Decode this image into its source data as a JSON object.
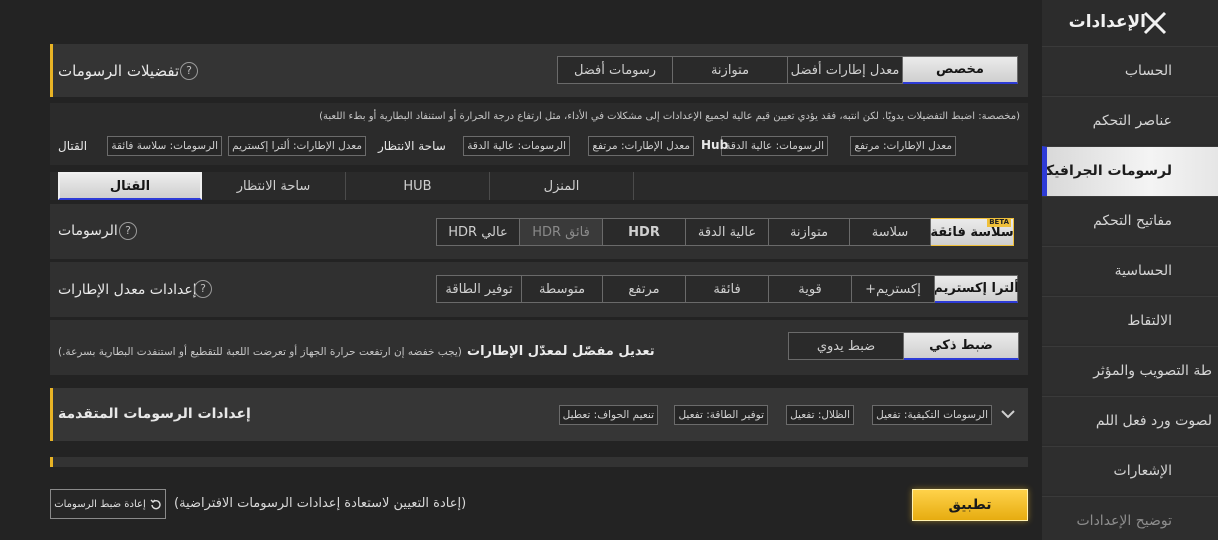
{
  "header": {
    "title": "الإعدادات"
  },
  "sidebar": {
    "items": [
      {
        "label": "الحساب"
      },
      {
        "label": "عناصر التحكم"
      },
      {
        "label": "لرسومات الجرافيكية"
      },
      {
        "label": "مفاتيح التحكم"
      },
      {
        "label": "الحساسية"
      },
      {
        "label": "الالتقاط"
      },
      {
        "label": "طة التصويب والمؤثر"
      },
      {
        "label": "لصوت ورد فعل اللم"
      },
      {
        "label": "الإشعارات"
      },
      {
        "label": "توضيح الإعدادات"
      }
    ],
    "active_index": 2
  },
  "preferences": {
    "title": "تفضيلات الرسومات",
    "help": "?",
    "options": [
      "مخصص",
      "معدل إطارات أفضل",
      "متوازنة",
      "رسومات أفضل"
    ],
    "selected": "مخصص",
    "note": "(مخصصة: اضبط التفضيلات يدويًا. لكن انتبه، فقد يؤدي تعيين قيم عالية لجميع الإعدادات إلى مشكلات في الأداء، مثل ارتفاع درجة الحرارة أو استنفاد البطارية أو بطء اللعبة)",
    "summary": [
      {
        "mode": "Hub",
        "chips": [
          "معدل الإطارات: مرتفع",
          "الرسومات: عالية الدقة"
        ]
      },
      {
        "mode": "ساحة الانتظار",
        "chips": [
          "معدل الإطارات: مرتفع",
          "الرسومات: عالية الدقة"
        ]
      },
      {
        "mode": "القتال",
        "chips": [
          "معدل الإطارات: ألترا إكستريم",
          "الرسومات: سلاسة فائقة"
        ]
      }
    ]
  },
  "mode_tabs": {
    "items": [
      "القتال",
      "ساحة الانتظار",
      "HUB",
      "المنزل"
    ],
    "selected": "القتال"
  },
  "graphics": {
    "label": "الرسومات",
    "options": [
      "سلاسة فائقة",
      "سلاسة",
      "متوازنة",
      "عالية الدقة",
      "HDR",
      "فائق HDR",
      "عالي HDR"
    ],
    "selected": "سلاسة فائقة",
    "beta_label": "BETA"
  },
  "frame_rate": {
    "label": "إعدادات معدل الإطارات",
    "options": [
      "ألترا إكستريم",
      "إكستريم+",
      "قوية",
      "فائقة",
      "مرتفع",
      "متوسطة",
      "توفير الطاقة"
    ],
    "selected": "ألترا إكستريم"
  },
  "adaptive": {
    "title": "تعديل مفصّل لمعدّل الإطارات",
    "note": "(يجب خفضه إن ارتفعت حرارة الجهاز أو تعرضت اللعبة للتقطيع أو استنفدت البطارية بسرعة.)",
    "options": [
      "ضبط ذكي",
      "ضبط يدوي"
    ],
    "selected": "ضبط ذكي"
  },
  "advanced": {
    "title": "إعدادات الرسومات المتقدمة",
    "chips": [
      "الرسومات التكيفية: تفعيل",
      "الظلال: تفعيل",
      "توفير الطاقة: تفعيل",
      "تنعيم الحواف: تعطيل"
    ]
  },
  "footer": {
    "apply": "تطبيق",
    "reset_hint": "(إعادة التعيين لاستعادة إعدادات الرسومات الافتراضية)",
    "reset_button": "إعادة ضبط الرسومات"
  },
  "colors": {
    "accent_gold": "#e8b325",
    "select_blue": "#2d3bd6"
  }
}
